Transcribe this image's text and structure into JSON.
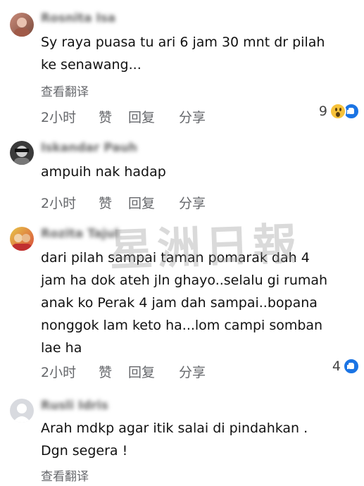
{
  "comments": [
    {
      "name": "Rosnita Isa",
      "text_lines": [
        "Sy raya puasa tu ari 6 jam 30 mnt dr pilah",
        "ke senawang..."
      ],
      "translate": "查看翻译",
      "time": "2小时",
      "like": "赞",
      "reply": "回复",
      "share": "分享",
      "reaction_count": "9",
      "reaction_icons": [
        "wow-icon",
        "like-icon"
      ]
    },
    {
      "name": "Iskandar Pauh",
      "text_lines": [
        "ampuih nak hadap"
      ],
      "time": "2小时",
      "like": "赞",
      "reply": "回复",
      "share": "分享"
    },
    {
      "name": "Rozita Tajul",
      "text_lines": [
        "dari pilah sampai taman pomarak dah 4",
        "jam ha dok ateh jln ghayo..selalu gi rumah",
        "anak ko Perak 4 jam dah sampai..bopana",
        "nonggok lam keto ha...lom campi somban",
        "lae ha"
      ],
      "time": "2小时",
      "like": "赞",
      "reply": "回复",
      "share": "分享",
      "reaction_count": "4",
      "reaction_icons": [
        "like-icon"
      ]
    },
    {
      "name": "Rusli Idris",
      "text_lines": [
        "Arah mdkp agar itik salai di pindahkan .",
        "Dgn segera !"
      ],
      "translate": "查看翻译"
    }
  ],
  "watermark": "星洲日報",
  "colors": {
    "meta": "#65676b",
    "like_blue": "#1b74e4",
    "wow_yellow": "#f7c23a"
  }
}
